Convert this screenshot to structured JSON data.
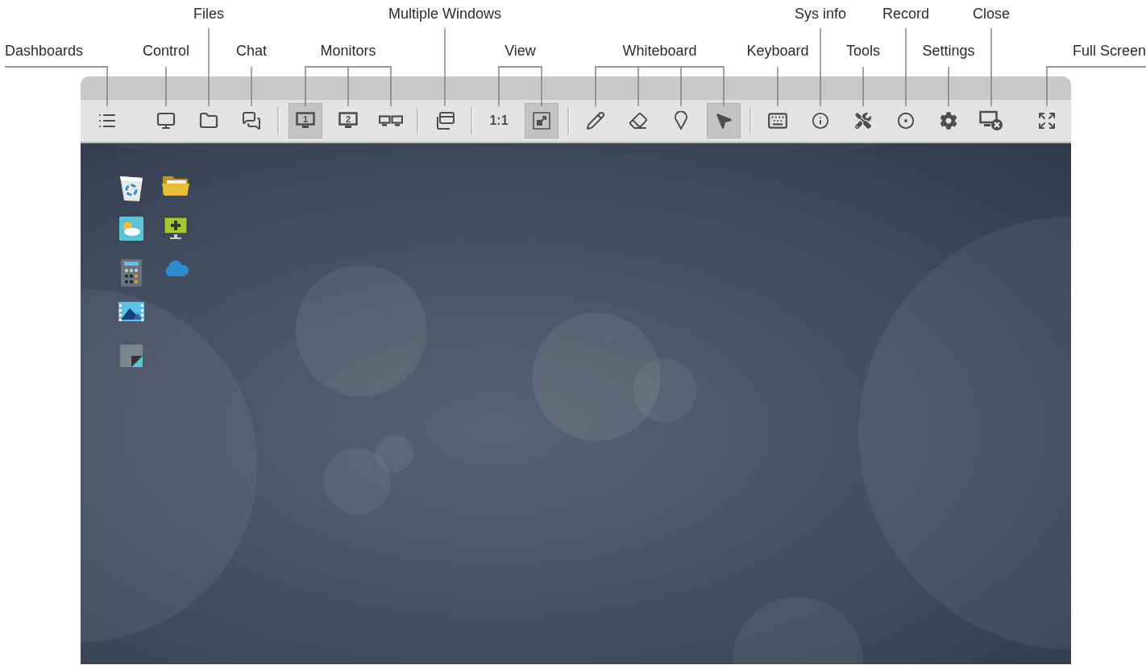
{
  "callouts": [
    {
      "label": "Dashboards",
      "buttons": [
        {
          "kind": "list",
          "selected": false
        }
      ]
    },
    {
      "label": "Control",
      "buttons": [
        {
          "kind": "monitor",
          "selected": false
        }
      ]
    },
    {
      "label": "Files",
      "buttons": [
        {
          "kind": "folder",
          "selected": false
        }
      ]
    },
    {
      "label": "Chat",
      "buttons": [
        {
          "kind": "chat",
          "selected": false
        }
      ]
    },
    {
      "label": "Monitors",
      "buttons": [
        {
          "kind": "numbered-monitor",
          "text": "1",
          "selected": true,
          "separator_before": true
        },
        {
          "kind": "numbered-monitor",
          "text": "2",
          "selected": false
        },
        {
          "kind": "dual-monitor",
          "selected": false
        }
      ]
    },
    {
      "label": "Multiple Windows",
      "buttons": [
        {
          "kind": "windows",
          "selected": false,
          "separator_before": true
        }
      ]
    },
    {
      "label": "View",
      "buttons": [
        {
          "kind": "text",
          "text": "1:1",
          "selected": false,
          "separator_before": true
        },
        {
          "kind": "fit",
          "selected": true
        }
      ]
    },
    {
      "label": "Whiteboard",
      "buttons": [
        {
          "kind": "pencil",
          "selected": false,
          "separator_before": true
        },
        {
          "kind": "eraser",
          "selected": false
        },
        {
          "kind": "pin",
          "selected": false
        },
        {
          "kind": "pointer",
          "selected": true
        }
      ]
    },
    {
      "label": "Keyboard",
      "buttons": [
        {
          "kind": "keyboard",
          "selected": false,
          "separator_before": true
        }
      ]
    },
    {
      "label": "Sys info",
      "buttons": [
        {
          "kind": "info",
          "selected": false
        }
      ]
    },
    {
      "label": "Tools",
      "buttons": [
        {
          "kind": "tools",
          "selected": false
        }
      ]
    },
    {
      "label": "Record",
      "buttons": [
        {
          "kind": "record",
          "selected": false
        }
      ]
    },
    {
      "label": "Settings",
      "buttons": [
        {
          "kind": "gear",
          "selected": false
        }
      ]
    },
    {
      "label": "Close",
      "buttons": [
        {
          "kind": "close-monitor",
          "selected": false
        }
      ]
    },
    {
      "label": "Full Screen",
      "buttons": [
        {
          "kind": "fullscreen",
          "selected": false
        }
      ]
    }
  ]
}
